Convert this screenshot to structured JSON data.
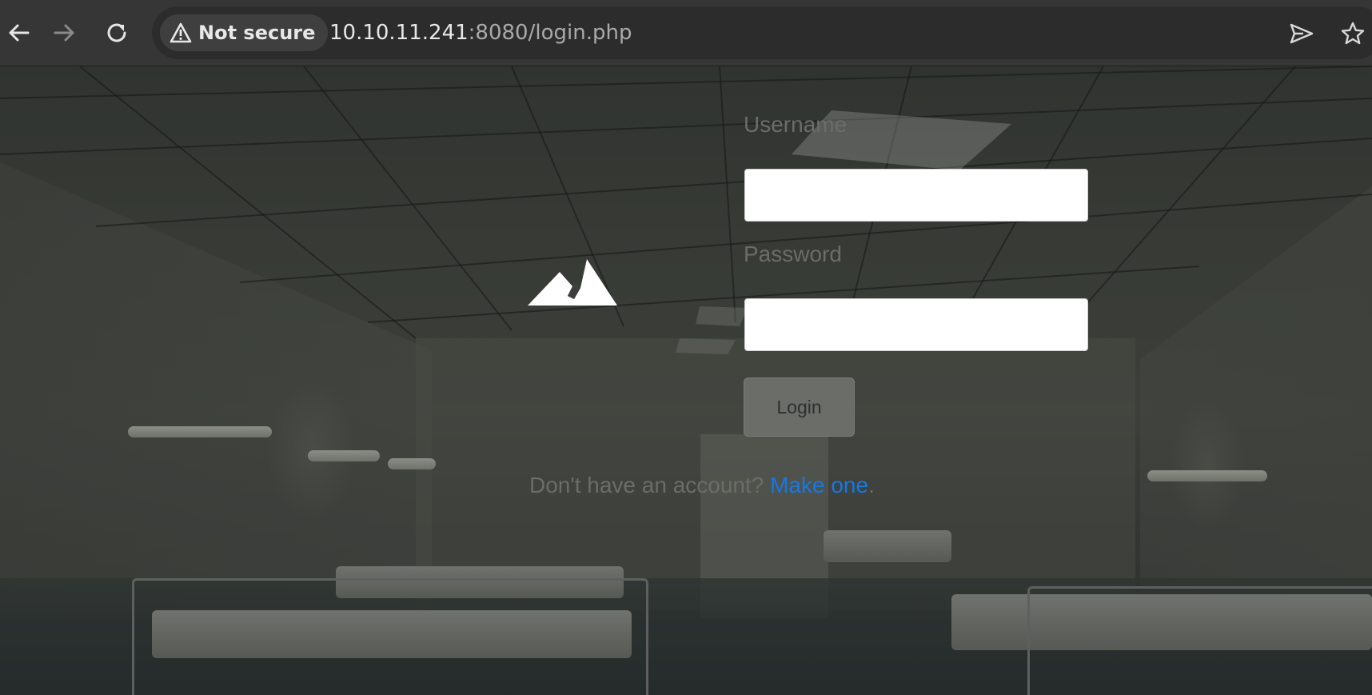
{
  "browser": {
    "back_icon": "arrow-left-icon",
    "forward_icon": "arrow-right-icon",
    "reload_icon": "reload-icon",
    "security": {
      "icon": "warning-triangle-icon",
      "label": "Not secure"
    },
    "url": {
      "host": "10.10.11.241",
      "rest": ":8080/login.php"
    },
    "send_icon": "send-icon",
    "bookmark_icon": "star-icon"
  },
  "login": {
    "logo_icon": "mountain-logo-icon",
    "username_label": "Username",
    "username_value": "",
    "password_label": "Password",
    "password_value": "",
    "button_label": "Login",
    "signup_text": "Don't have an account? ",
    "signup_link": "Make one",
    "signup_suffix": "."
  },
  "colors": {
    "link": "#1479e6",
    "label": "#6c6c68",
    "button_bg": "#6b6d69"
  }
}
